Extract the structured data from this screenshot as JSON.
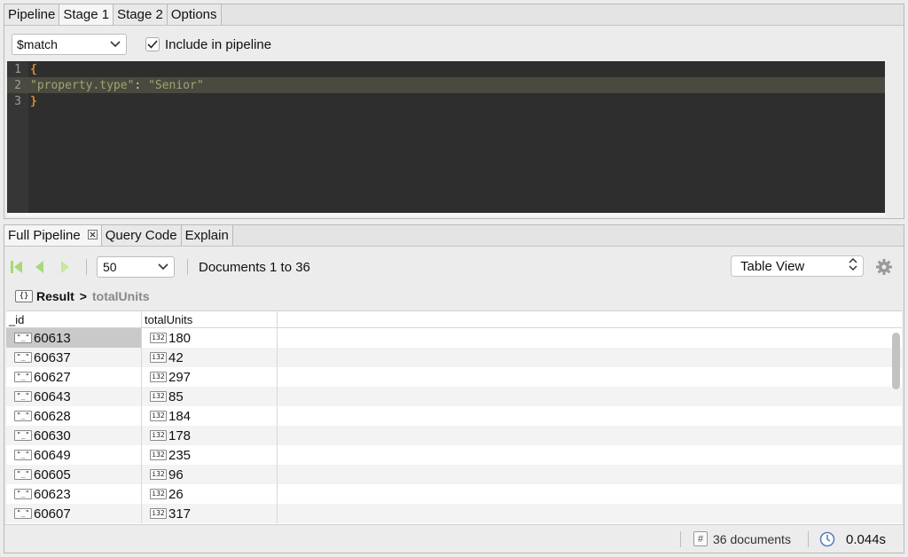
{
  "top_tabs": [
    "Pipeline",
    "Stage 1",
    "Stage 2",
    "Options"
  ],
  "stage": {
    "operator": "$match",
    "include_label": "Include in pipeline",
    "include_checked": true
  },
  "editor": {
    "line_numbers": [
      "1",
      "2",
      "3"
    ],
    "open_brace": "{",
    "key": "\"property.type\"",
    "colon": ":",
    "value": "\"Senior\"",
    "close_brace": "}"
  },
  "bottom_tabs": [
    "Full Pipeline",
    "Query Code",
    "Explain"
  ],
  "toolbar": {
    "page_size": "50",
    "doc_range": "Documents 1 to 36",
    "view_mode": "Table View"
  },
  "breadcrumb": {
    "icon_text": "{}",
    "root": "Result",
    "separator": ">",
    "leaf": "totalUnits"
  },
  "table": {
    "columns": [
      "_id",
      "totalUnits"
    ],
    "id_type_icon": "\"_\"",
    "val_type_icon": "i32",
    "rows": [
      {
        "id": "60613",
        "value": "180"
      },
      {
        "id": "60637",
        "value": "42"
      },
      {
        "id": "60627",
        "value": "297"
      },
      {
        "id": "60643",
        "value": "85"
      },
      {
        "id": "60628",
        "value": "184"
      },
      {
        "id": "60630",
        "value": "178"
      },
      {
        "id": "60649",
        "value": "235"
      },
      {
        "id": "60605",
        "value": "96"
      },
      {
        "id": "60623",
        "value": "26"
      },
      {
        "id": "60607",
        "value": "317"
      }
    ]
  },
  "status": {
    "hash_icon": "#",
    "doc_count": "36 documents",
    "time": "0.044s"
  },
  "colors": {
    "editor_bg": "#2e2e2e",
    "brace": "#e08a2c",
    "string": "#a3a370",
    "nav_green": "#9fd86a"
  }
}
